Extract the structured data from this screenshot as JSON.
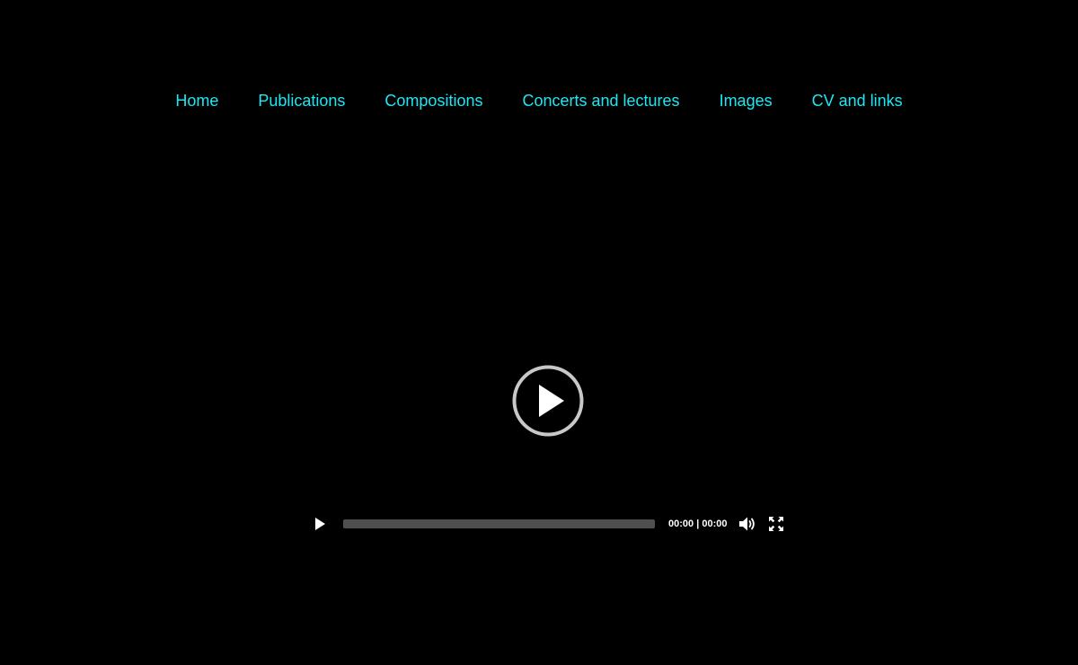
{
  "nav": {
    "items": [
      {
        "label": "Home"
      },
      {
        "label": "Publications"
      },
      {
        "label": "Compositions"
      },
      {
        "label": "Concerts and lectures"
      },
      {
        "label": "Images"
      },
      {
        "label": "CV and links"
      }
    ]
  },
  "player": {
    "current_time": "00:00",
    "separator": "|",
    "duration": "00:00",
    "progress": 0,
    "icons": {
      "big_play": "play-circle-icon",
      "play": "play-icon",
      "volume": "volume-icon",
      "fullscreen": "fullscreen-icon"
    }
  },
  "colors": {
    "background": "#000000",
    "nav_link": "#1fe6f2",
    "progress_track": "#4f4f4f",
    "control_icons": "#ffffff",
    "big_play_ring": "#c8c8c8"
  }
}
